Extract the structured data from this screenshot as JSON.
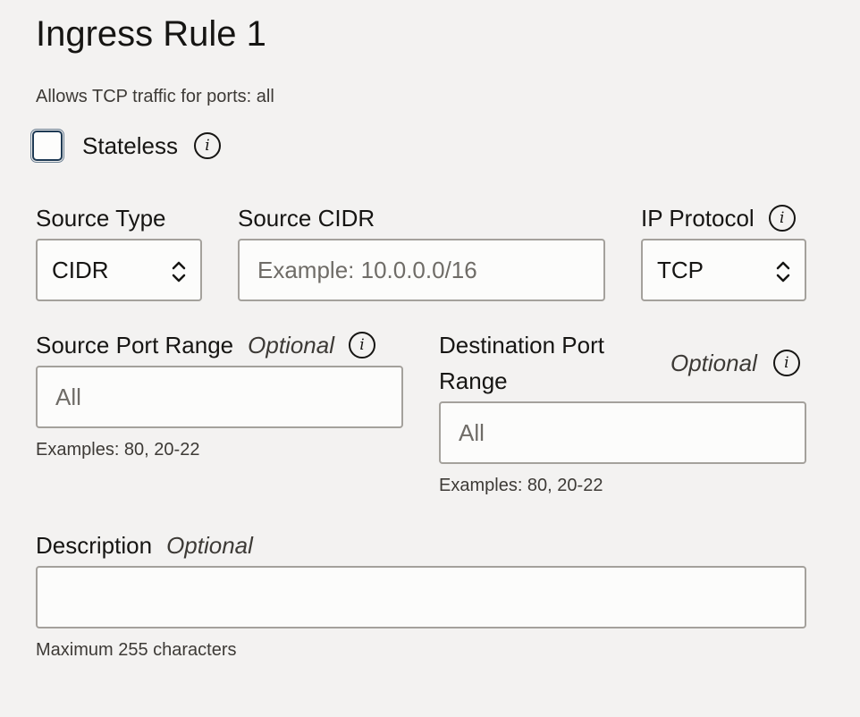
{
  "rule": {
    "title": "Ingress Rule 1",
    "summary": "Allows TCP traffic for ports: all"
  },
  "stateless": {
    "label": "Stateless",
    "checked": false
  },
  "source_type": {
    "label": "Source Type",
    "value": "CIDR"
  },
  "source_cidr": {
    "label": "Source CIDR",
    "value": "",
    "placeholder": "Example: 10.0.0.0/16"
  },
  "ip_protocol": {
    "label": "IP Protocol",
    "value": "TCP"
  },
  "source_port_range": {
    "label": "Source Port Range",
    "optional": "Optional",
    "value": "",
    "placeholder": "All",
    "help": "Examples: 80, 20-22"
  },
  "destination_port_range": {
    "label_line1": "Destination Port",
    "label_line2": "Range",
    "optional": "Optional",
    "value": "",
    "placeholder": "All",
    "help": "Examples: 80, 20-22"
  },
  "description": {
    "label": "Description",
    "optional": "Optional",
    "value": "",
    "help": "Maximum 255 characters"
  },
  "icons": {
    "info": "info-icon",
    "select": "select-arrows-icon"
  },
  "colors": {
    "background": "#f3f2f1",
    "text": "#161513",
    "input_border": "#a4a19c",
    "checkbox_border": "#1e3a54"
  }
}
